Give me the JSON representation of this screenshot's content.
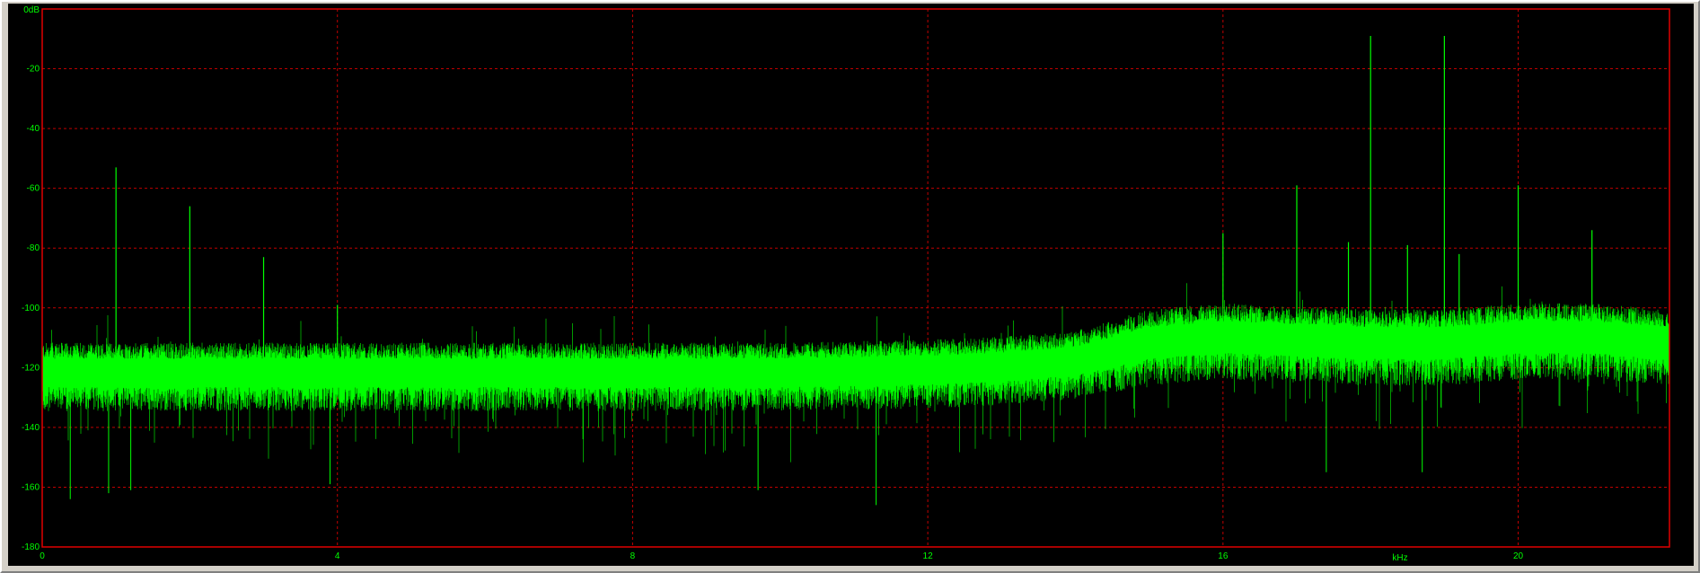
{
  "chart_data": {
    "type": "line",
    "title": "",
    "xlabel": "kHz",
    "ylabel": "",
    "xlim": [
      0,
      22.05
    ],
    "ylim": [
      -180,
      0
    ],
    "x_ticks": [
      0,
      4,
      8,
      12,
      16,
      20
    ],
    "x_tick_labels": [
      "0",
      "4",
      "8",
      "12",
      "16",
      "20"
    ],
    "y_ticks": [
      0,
      -20,
      -40,
      -60,
      -80,
      -100,
      -120,
      -140,
      -160,
      -180
    ],
    "y_tick_labels": [
      "0dB",
      "-20",
      "-40",
      "-60",
      "-80",
      "-100",
      "-120",
      "-140",
      "-160",
      "-180"
    ],
    "grid": true,
    "legend": "none",
    "colors": {
      "background": "#000000",
      "trace": "#00ff00",
      "grid": "#c00000",
      "frame": "#e00000",
      "text": "#00ff00"
    },
    "series": [
      {
        "style": "spectrum",
        "noise_floor_x": [
          0,
          2,
          4,
          6,
          8,
          10,
          12,
          13,
          14,
          15,
          16,
          17,
          18,
          19,
          20,
          21,
          22.05
        ],
        "noise_floor_mean_db": [
          -122,
          -122,
          -122,
          -122,
          -122,
          -122,
          -121,
          -120,
          -118,
          -112,
          -110,
          -111,
          -112,
          -112,
          -110,
          -110,
          -112
        ],
        "noise_floor_spread_db": [
          9,
          9,
          9,
          9,
          9,
          9,
          9,
          9,
          9,
          10,
          10,
          10,
          10,
          10,
          10,
          10,
          10
        ],
        "peaks": [
          {
            "x": 1.0,
            "y": -53
          },
          {
            "x": 2.0,
            "y": -66
          },
          {
            "x": 3.0,
            "y": -83
          },
          {
            "x": 4.0,
            "y": -99
          },
          {
            "x": 16.0,
            "y": -75
          },
          {
            "x": 17.0,
            "y": -59
          },
          {
            "x": 17.7,
            "y": -78
          },
          {
            "x": 18.0,
            "y": -9
          },
          {
            "x": 18.5,
            "y": -79
          },
          {
            "x": 19.0,
            "y": -9
          },
          {
            "x": 19.2,
            "y": -82
          },
          {
            "x": 20.0,
            "y": -59
          },
          {
            "x": 21.0,
            "y": -74
          }
        ],
        "dips": [
          {
            "x": 0.38,
            "y": -164
          },
          {
            "x": 0.9,
            "y": -162
          },
          {
            "x": 1.2,
            "y": -161
          },
          {
            "x": 3.9,
            "y": -159
          },
          {
            "x": 9.7,
            "y": -161
          },
          {
            "x": 11.3,
            "y": -166
          },
          {
            "x": 17.4,
            "y": -155
          },
          {
            "x": 18.7,
            "y": -155
          }
        ]
      }
    ]
  }
}
